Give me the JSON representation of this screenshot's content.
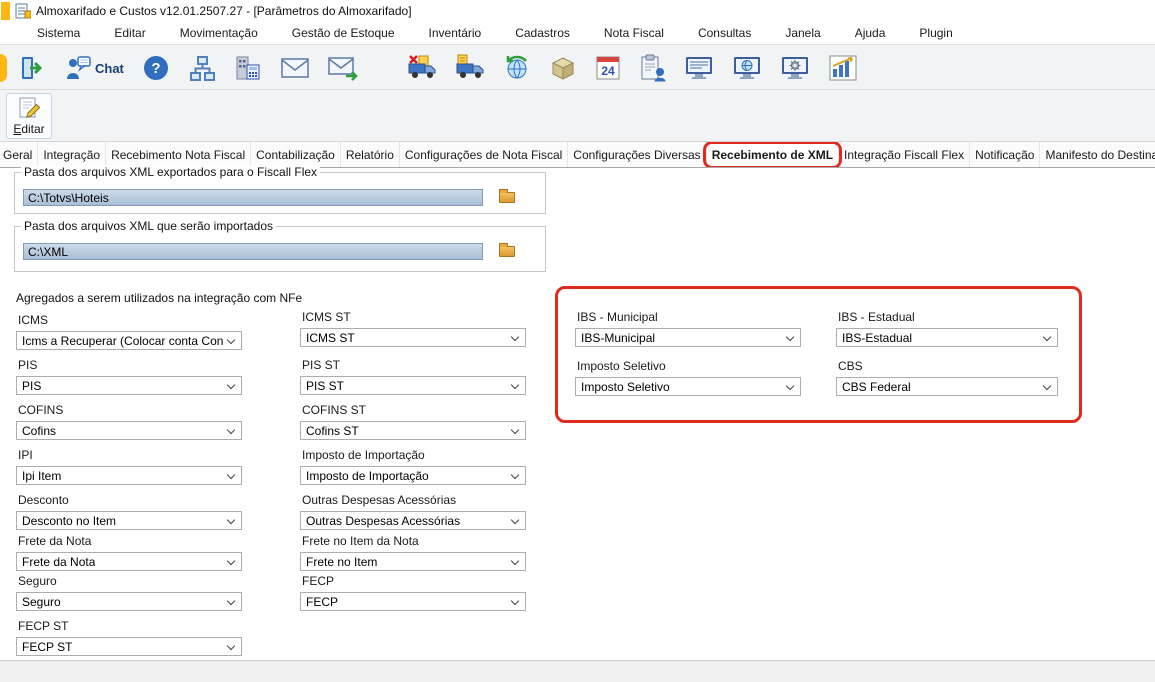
{
  "window": {
    "title": "Almoxarifado e Custos v12.01.2507.27 - [Parâmetros do Almoxarifado]"
  },
  "menu": {
    "items": [
      "Sistema",
      "Editar",
      "Movimentação",
      "Gestão de Estoque",
      "Inventário",
      "Cadastros",
      "Nota Fiscal",
      "Consultas",
      "Janela",
      "Ajuda",
      "Plugin"
    ]
  },
  "toolbar": {
    "chat_label": "Chat",
    "calendar_badge": "24",
    "edit_button_label": "Editar",
    "icon_names_group1": [
      "exit-icon",
      "user-chat-icon",
      "help-icon",
      "hierarchy-icon",
      "company-calculator-icon",
      "mail-icon",
      "mail-send-icon"
    ],
    "icon_names_group2": [
      "truck-cancel-icon",
      "truck-document-icon",
      "globe-sync-icon",
      "package-icon",
      "calendar-24-icon",
      "clipboard-user-icon",
      "monitor-list-icon",
      "monitor-globe-icon",
      "monitor-settings-icon",
      "chart-icon"
    ]
  },
  "tabs": {
    "active": "Recebimento de XML",
    "items": [
      "Geral",
      "Integração",
      "Recebimento Nota Fiscal",
      "Contabilização",
      "Relatório",
      "Configurações de Nota Fiscal",
      "Configurações Diversas",
      "Recebimento de XML",
      "Integração Fiscall Flex",
      "Notificação",
      "Manifesto do Destinatário"
    ]
  },
  "content": {
    "folder_group_1": {
      "label": "Pasta dos arquivos XML exportados para o Fiscall Flex",
      "value": "C:\\Totvs\\Hoteis"
    },
    "folder_group_2": {
      "label": "Pasta dos arquivos XML que serão importados",
      "value": "C:\\XML"
    },
    "aggregates_title": "Agregados a serem utilizados na integração com NFe",
    "col1": [
      {
        "label": "ICMS",
        "value": "Icms a Recuperar (Colocar conta Contab"
      },
      {
        "label": "PIS",
        "value": "PIS"
      },
      {
        "label": "COFINS",
        "value": "Cofins"
      },
      {
        "label": "IPI",
        "value": "Ipi Item"
      },
      {
        "label": "Desconto",
        "value": "Desconto no Item"
      },
      {
        "label": "Frete da Nota",
        "value": "Frete da Nota"
      },
      {
        "label": "Seguro",
        "value": "Seguro"
      },
      {
        "label": "FECP ST",
        "value": "FECP ST"
      }
    ],
    "col2": [
      {
        "label": "ICMS ST",
        "value": "ICMS ST"
      },
      {
        "label": "PIS ST",
        "value": "PIS ST"
      },
      {
        "label": "COFINS ST",
        "value": "Cofins ST"
      },
      {
        "label": "Imposto de Importação",
        "value": "Imposto de Importação"
      },
      {
        "label": "Outras Despesas Acessórias",
        "value": "Outras Despesas Acessórias"
      },
      {
        "label": "Frete no Item da Nota",
        "value": "Frete no Item"
      },
      {
        "label": "FECP",
        "value": "FECP"
      }
    ],
    "col3": [
      {
        "label": "IBS - Municipal",
        "value": "IBS-Municipal"
      },
      {
        "label": "Imposto Seletivo",
        "value": "Imposto Seletivo"
      }
    ],
    "col4": [
      {
        "label": "IBS - Estadual",
        "value": "IBS-Estadual"
      },
      {
        "label": "CBS",
        "value": "CBS Federal"
      }
    ]
  },
  "annotations": {
    "highlight_color": "#e02a1e"
  }
}
